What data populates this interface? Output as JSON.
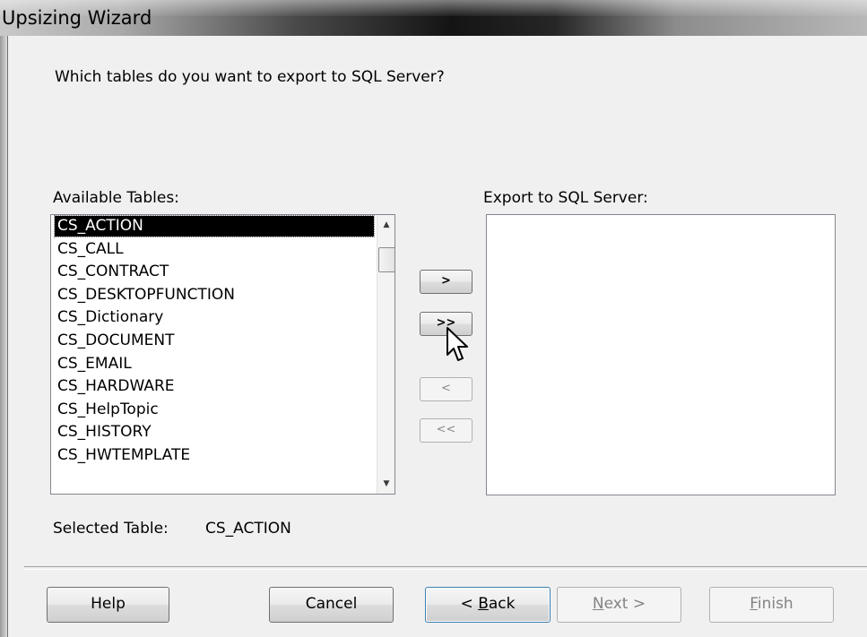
{
  "window": {
    "title": "Upsizing  Wizard"
  },
  "question": "Which tables do you want to export to SQL Server?",
  "available": {
    "label": "Available Tables:",
    "items": [
      "CS_ACTION",
      "CS_CALL",
      "CS_CONTRACT",
      "CS_DESKTOPFUNCTION",
      "CS_Dictionary",
      "CS_DOCUMENT",
      "CS_EMAIL",
      "CS_HARDWARE",
      "CS_HelpTopic",
      "CS_HISTORY",
      "CS_HWTEMPLATE"
    ],
    "selected_index": 0
  },
  "export": {
    "label": "Export to SQL Server:",
    "items": []
  },
  "move_buttons": {
    "add_one": ">",
    "add_all": ">>",
    "remove_one": "<",
    "remove_all": "<<"
  },
  "selected_table": {
    "label": "Selected Table:",
    "value": "CS_ACTION"
  },
  "buttons": {
    "help": "Help",
    "cancel": "Cancel",
    "back_prefix": "< ",
    "back_key": "B",
    "back_rest": "ack",
    "next_key": "N",
    "next_rest": "ext >",
    "finish_key": "F",
    "finish_rest": "inish"
  },
  "icons": {
    "cursor": "mouse-pointer-icon",
    "scroll_up": "scroll-up-arrow-icon",
    "scroll_down": "scroll-down-arrow-icon"
  }
}
